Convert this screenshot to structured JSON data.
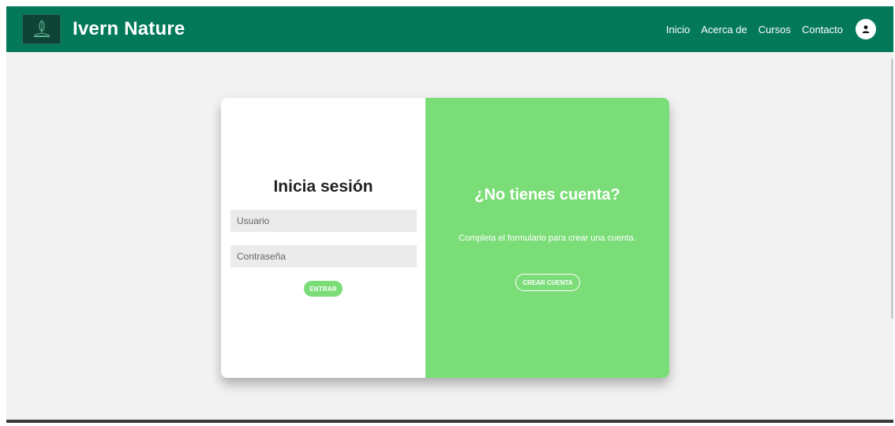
{
  "header": {
    "brand": "Ivern Nature",
    "logo_icon": "leaf-book-logo",
    "background_color": "#03795a",
    "nav": [
      {
        "label": "Inicio"
      },
      {
        "label": "Acerca de"
      },
      {
        "label": "Cursos"
      },
      {
        "label": "Contacto"
      }
    ],
    "user_icon": "user-icon"
  },
  "login": {
    "title": "Inicia sesión",
    "username_placeholder": "Usuario",
    "password_placeholder": "Contraseña",
    "submit_label": "ENTRAR"
  },
  "signup_panel": {
    "title": "¿No tienes cuenta?",
    "description": "Completa el formulario para crear una cuenta.",
    "button_label": "CREAR CUENTA",
    "background_color": "#7bdd78"
  }
}
